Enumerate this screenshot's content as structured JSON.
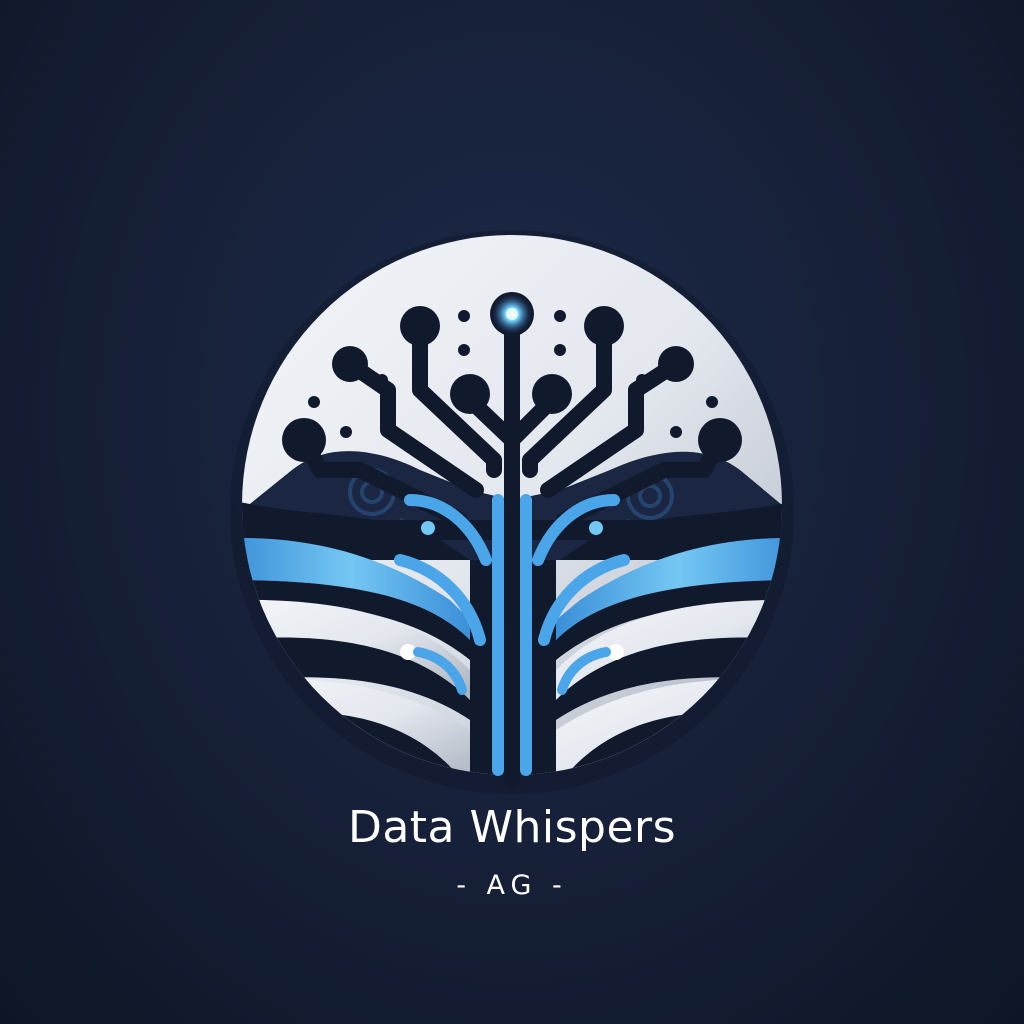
{
  "brand": {
    "name": "Data Whispers",
    "subtitle": "- AG -"
  },
  "logo": {
    "icon": "circuit-tree-emblem-icon",
    "colors": {
      "background": "#17213a",
      "silver": "#e9ecf1",
      "accent_blue": "#4aa6e8",
      "glow": "#6fd0ff",
      "text": "#ffffff"
    }
  }
}
